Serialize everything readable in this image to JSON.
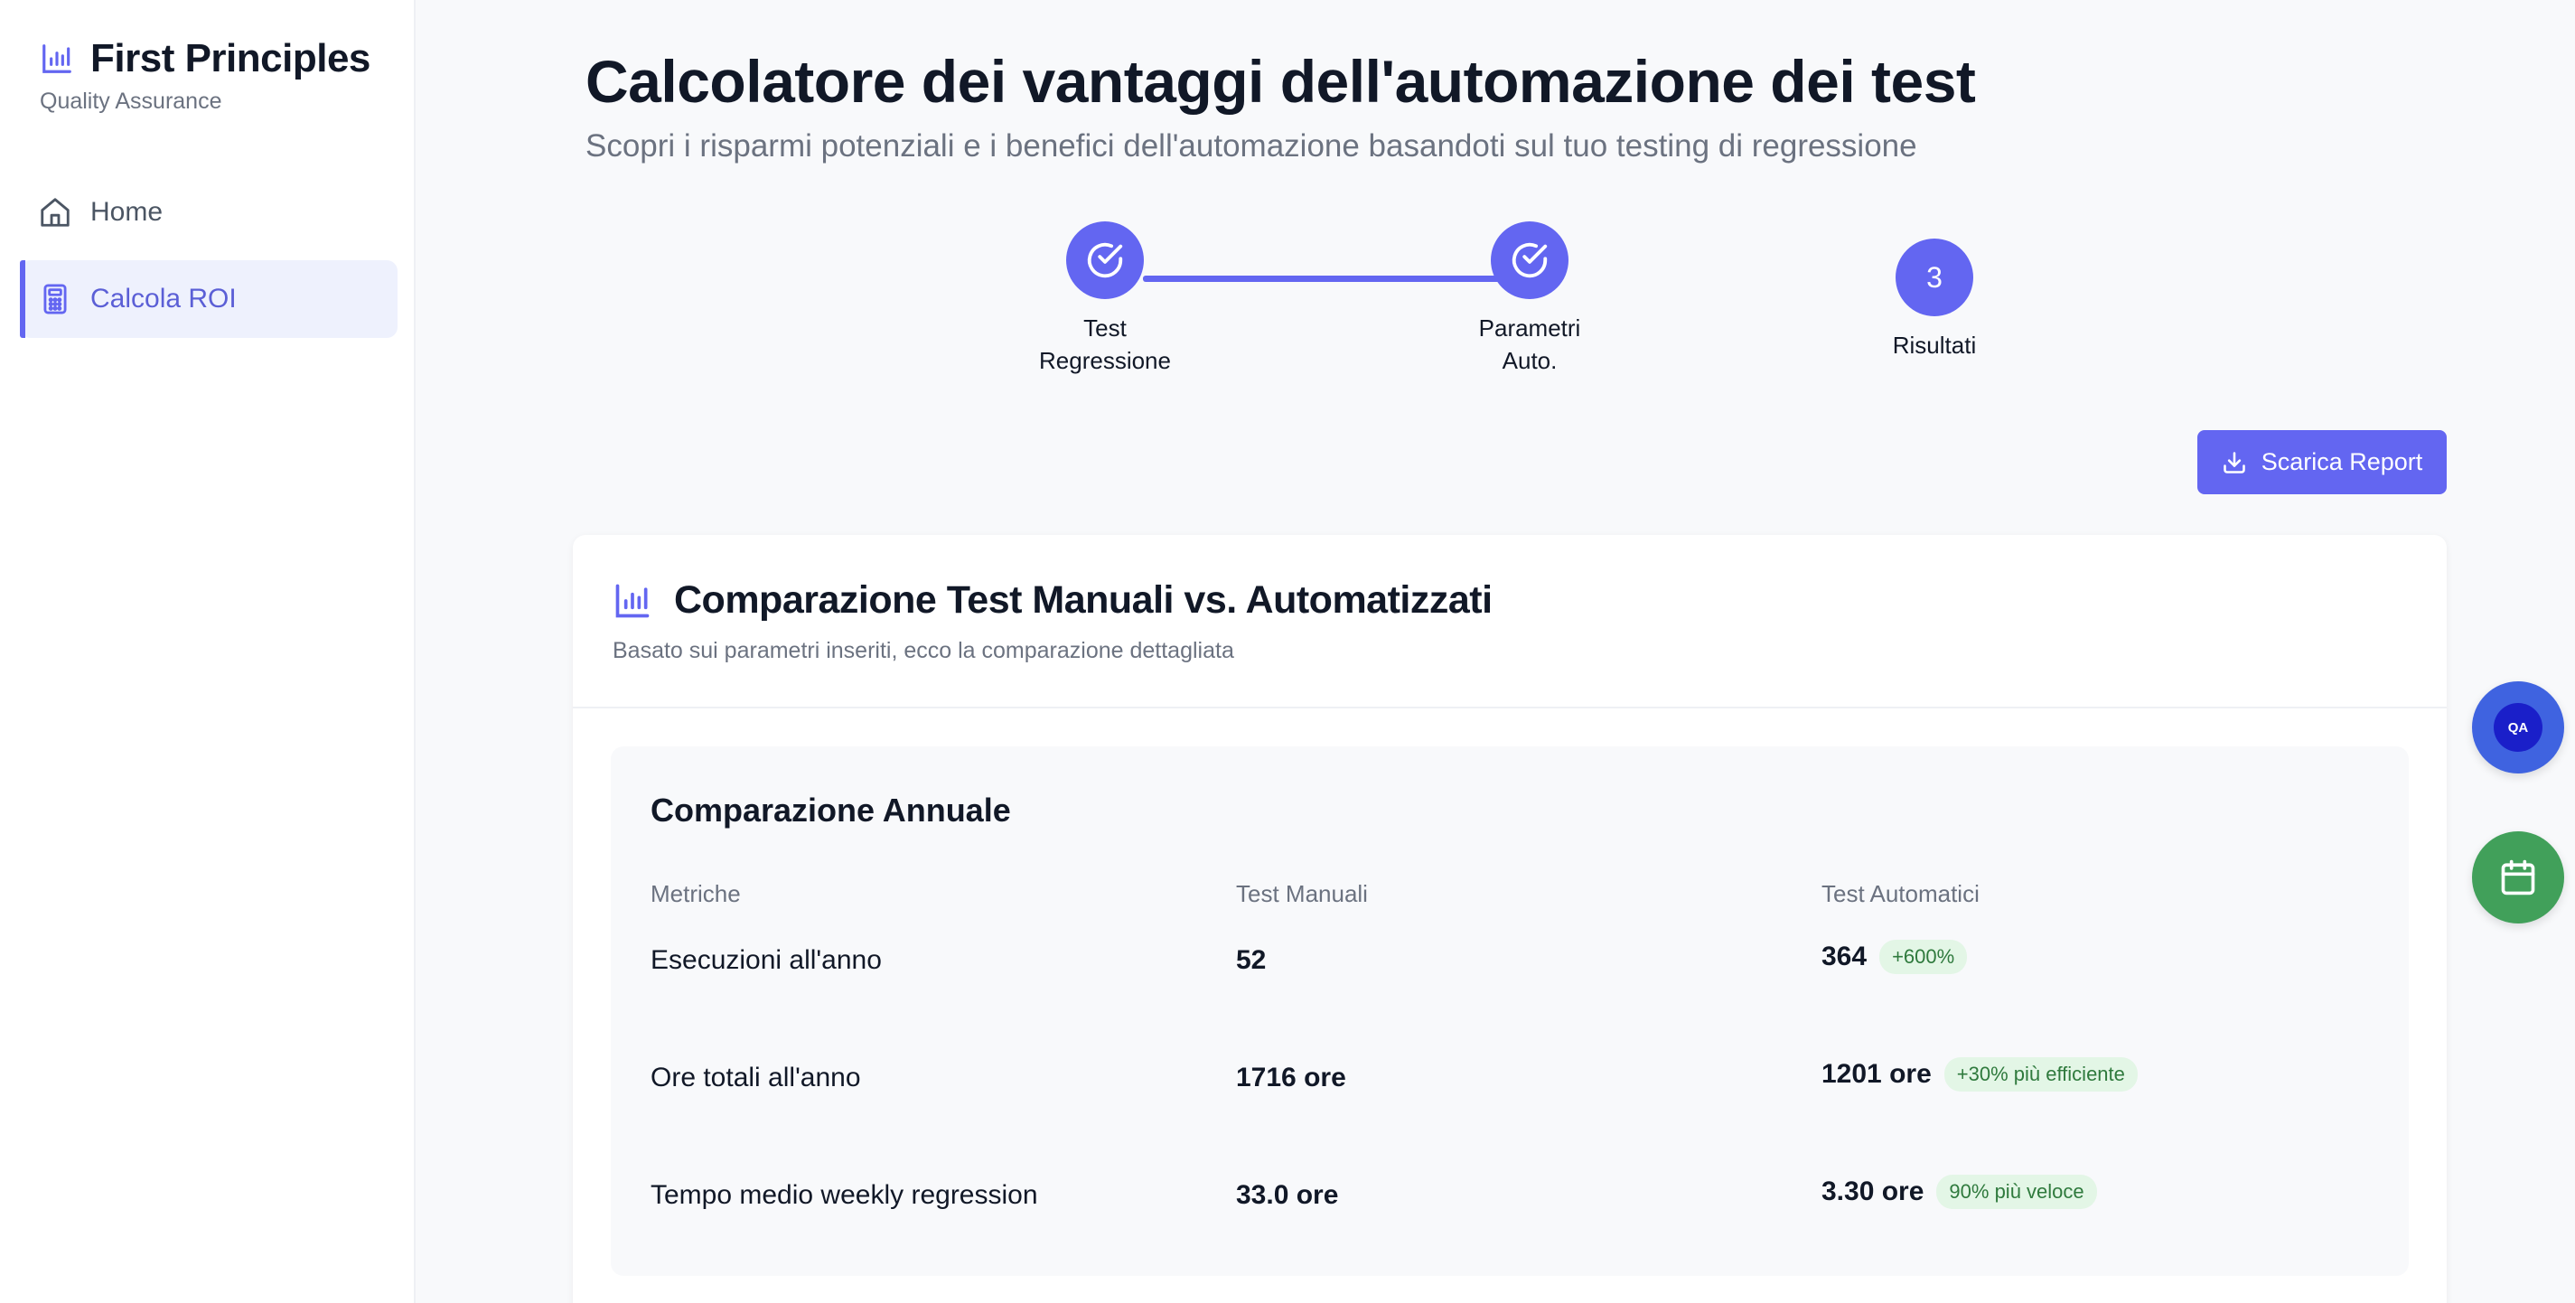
{
  "brand": {
    "title": "First Principles",
    "subtitle": "Quality Assurance"
  },
  "sidebar": {
    "items": [
      {
        "label": "Home",
        "icon": "home-icon",
        "active": false
      },
      {
        "label": "Calcola ROI",
        "icon": "calculator-icon",
        "active": true
      }
    ]
  },
  "header": {
    "title": "Calcolatore dei vantaggi dell'automazione dei test",
    "subtitle": "Scopri i risparmi potenziali e i benefici dell'automazione basandoti sul tuo testing di regressione"
  },
  "stepper": {
    "steps": [
      {
        "label_line1": "Test",
        "label_line2": "Regressione",
        "state": "completed",
        "icon": "check-circle-icon"
      },
      {
        "label_line1": "Parametri",
        "label_line2": "Auto.",
        "state": "completed",
        "icon": "check-circle-icon"
      },
      {
        "number": "3",
        "label_line1": "Risultati",
        "label_line2": "",
        "state": "current"
      }
    ]
  },
  "actions": {
    "download_label": "Scarica Report"
  },
  "comparison_card": {
    "title": "Comparazione Test Manuali vs. Automatizzati",
    "subtitle": "Basato sui parametri inseriti, ecco la comparazione dettagliata",
    "panel_title": "Comparazione Annuale",
    "columns": [
      "Metriche",
      "Test Manuali",
      "Test Automatici"
    ],
    "rows": [
      {
        "metric": "Esecuzioni all'anno",
        "manual": "52",
        "automated": "364",
        "badge": "+600%"
      },
      {
        "metric": "Ore totali all'anno",
        "manual": "1716 ore",
        "automated": "1201 ore",
        "badge": "+30% più efficiente"
      },
      {
        "metric": "Tempo medio weekly regression",
        "manual": "33.0 ore",
        "automated": "3.30 ore",
        "badge": "90% più veloce"
      }
    ]
  },
  "floating": {
    "qa_label": "QA"
  },
  "colors": {
    "accent": "#6366f1",
    "badge_bg": "#e3f6e6",
    "badge_text": "#2f7a3d",
    "fab_blue": "#3f63e0",
    "fab_green": "#41a05a"
  }
}
